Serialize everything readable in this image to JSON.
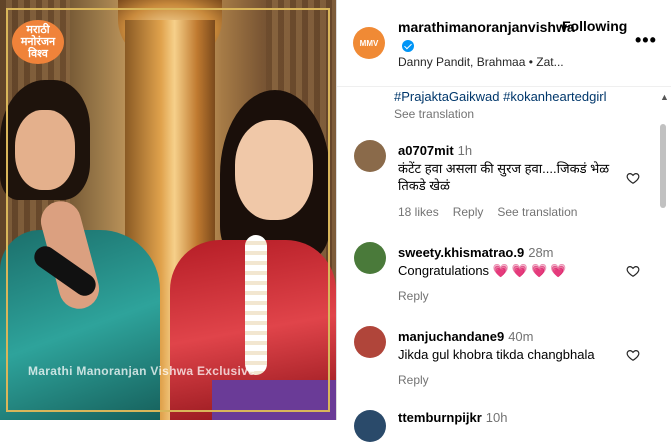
{
  "media": {
    "logo_text": "मराठी मनोरंजन विश्व",
    "watermark": "Marathi Manoranjan Vishwa Exclusive"
  },
  "post": {
    "username": "marathimanoranjanvishwa",
    "follow_label": "Following",
    "subline": "Danny Pandit, Brahmaa • Zat...",
    "more_icon": "more-icon",
    "hashtags": "#PrajaktaGaikwad #kokanheartedgirl",
    "see_translation": "See translation"
  },
  "comments": [
    {
      "username": "a0707mit",
      "time": "1h",
      "text": "कंटेंट हवा असला की सुरज हवा....जिकडं भेळ तिकडे खेळं",
      "likes": "18 likes",
      "reply": "Reply",
      "see_translation": "See translation",
      "avatar_color": "#8a6a4a"
    },
    {
      "username": "sweety.khismatrao.9",
      "time": "28m",
      "text": "Congratulations",
      "emojis": "💗💗💗💗",
      "reply": "Reply",
      "avatar_color": "#4a7a3a"
    },
    {
      "username": "manjuchandane9",
      "time": "40m",
      "text": "Jikda gul khobra tikda changbhala",
      "reply": "Reply",
      "avatar_color": "#b0453a"
    },
    {
      "username": "ttemburnpijkr",
      "time": "10h"
    }
  ],
  "colors": {
    "link": "#00376b",
    "verified": "#0095f6",
    "muted": "#737373",
    "heart_emoji": "#ed3b6b"
  }
}
